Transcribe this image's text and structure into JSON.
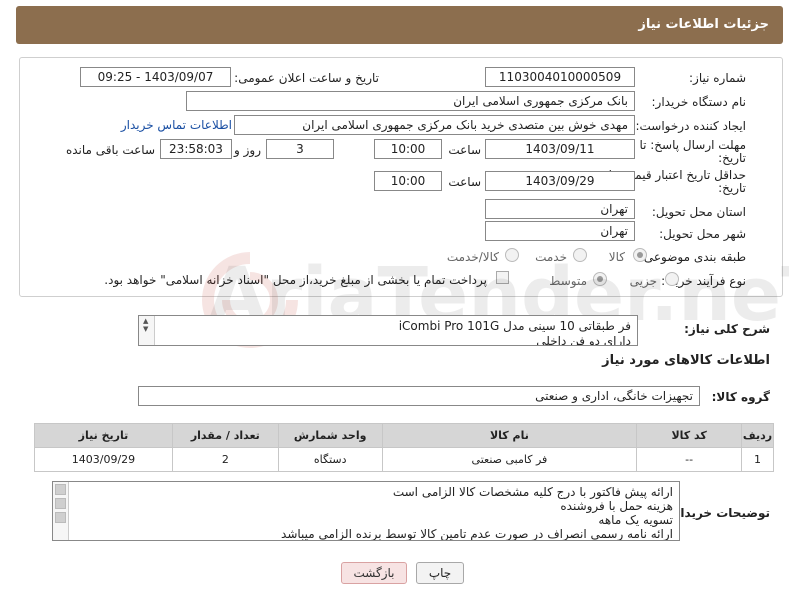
{
  "header": {
    "title": "جزئیات اطلاعات نیاز"
  },
  "form": {
    "need_number_label": "شماره نیاز:",
    "need_number_value": "1103004010000509",
    "announce_label": "تاریخ و ساعت اعلان عمومی:",
    "announce_value": "1403/09/07 - 09:25",
    "buyer_org_label": "نام دستگاه خریدار:",
    "buyer_org_value": "بانک مرکزی جمهوری اسلامی ایران",
    "requester_label": "ایجاد کننده درخواست:",
    "requester_value": "مهدی خوش بین متصدی خرید بانک مرکزی جمهوری اسلامی ایران",
    "buyer_contact_link": "اطلاعات تماس خریدار",
    "reply_deadline_label_1": "مهلت ارسال پاسخ: تا",
    "reply_deadline_label_2": "تاریخ:",
    "reply_date_value": "1403/09/11",
    "time_label": "ساعت",
    "reply_time_value": "10:00",
    "days_value": "3",
    "days_label": "روز و",
    "remaining_value": "23:58:03",
    "remaining_label": "ساعت باقی مانده",
    "price_validity_label_1": "حداقل تاریخ اعتبار قیمت: تا",
    "price_validity_label_2": "تاریخ:",
    "validity_date_value": "1403/09/29",
    "validity_time_value": "10:00",
    "province_label": "استان محل تحویل:",
    "province_value": "تهران",
    "city_label": "شهر محل تحویل:",
    "city_value": "تهران",
    "category_label": "طبقه بندی موضوعی:",
    "category_options": [
      "کالا",
      "خدمت",
      "کالا/خدمت"
    ],
    "process_label": "نوع فرآیند خرید :",
    "process_options": [
      "جزیی",
      "متوسط"
    ],
    "payment_note": "پرداخت تمام یا بخشی از مبلغ خرید،از محل \"اسناد خزانه اسلامی\" خواهد بود."
  },
  "description": {
    "label": "شرح کلی نیاز:",
    "lines": [
      "فر طبقاتی 10 سینی مدل iCombi Pro 101G",
      "دارای دو فن داخلی"
    ]
  },
  "goods_section": {
    "title": "اطلاعات کالاهای مورد نیاز",
    "group_label": "گروه کالا:",
    "group_value": "تجهیزات خانگی، اداری و صنعتی"
  },
  "table": {
    "headers": [
      "ردیف",
      "کد کالا",
      "نام کالا",
      "واحد شمارش",
      "تعداد / مقدار",
      "تاریخ نیاز"
    ],
    "rows": [
      [
        "1",
        "--",
        "فر کامبی صنعتی",
        "دستگاه",
        "2",
        "1403/09/29"
      ]
    ]
  },
  "buyer_notes": {
    "label": "توضیحات خریدار:",
    "lines": [
      "ارائه پیش فاکتور با درج کلیه مشخصات کالا الزامی است",
      "هزینه حمل با فروشنده",
      "تسویه یک ماهه",
      "ارائه نامه رسمی انصراف در صورت عدم تامین کالا توسط برنده الزامی میباشد"
    ]
  },
  "buttons": {
    "print": "چاپ",
    "back": "بازگشت"
  },
  "watermark": {
    "text": "AriaTender.neT"
  },
  "colors": {
    "header_bg": "#8c6e4e",
    "table_header_bg": "#d6d6d6",
    "link": "#1a4fa3",
    "back_btn_bg": "#f7e3e3"
  }
}
